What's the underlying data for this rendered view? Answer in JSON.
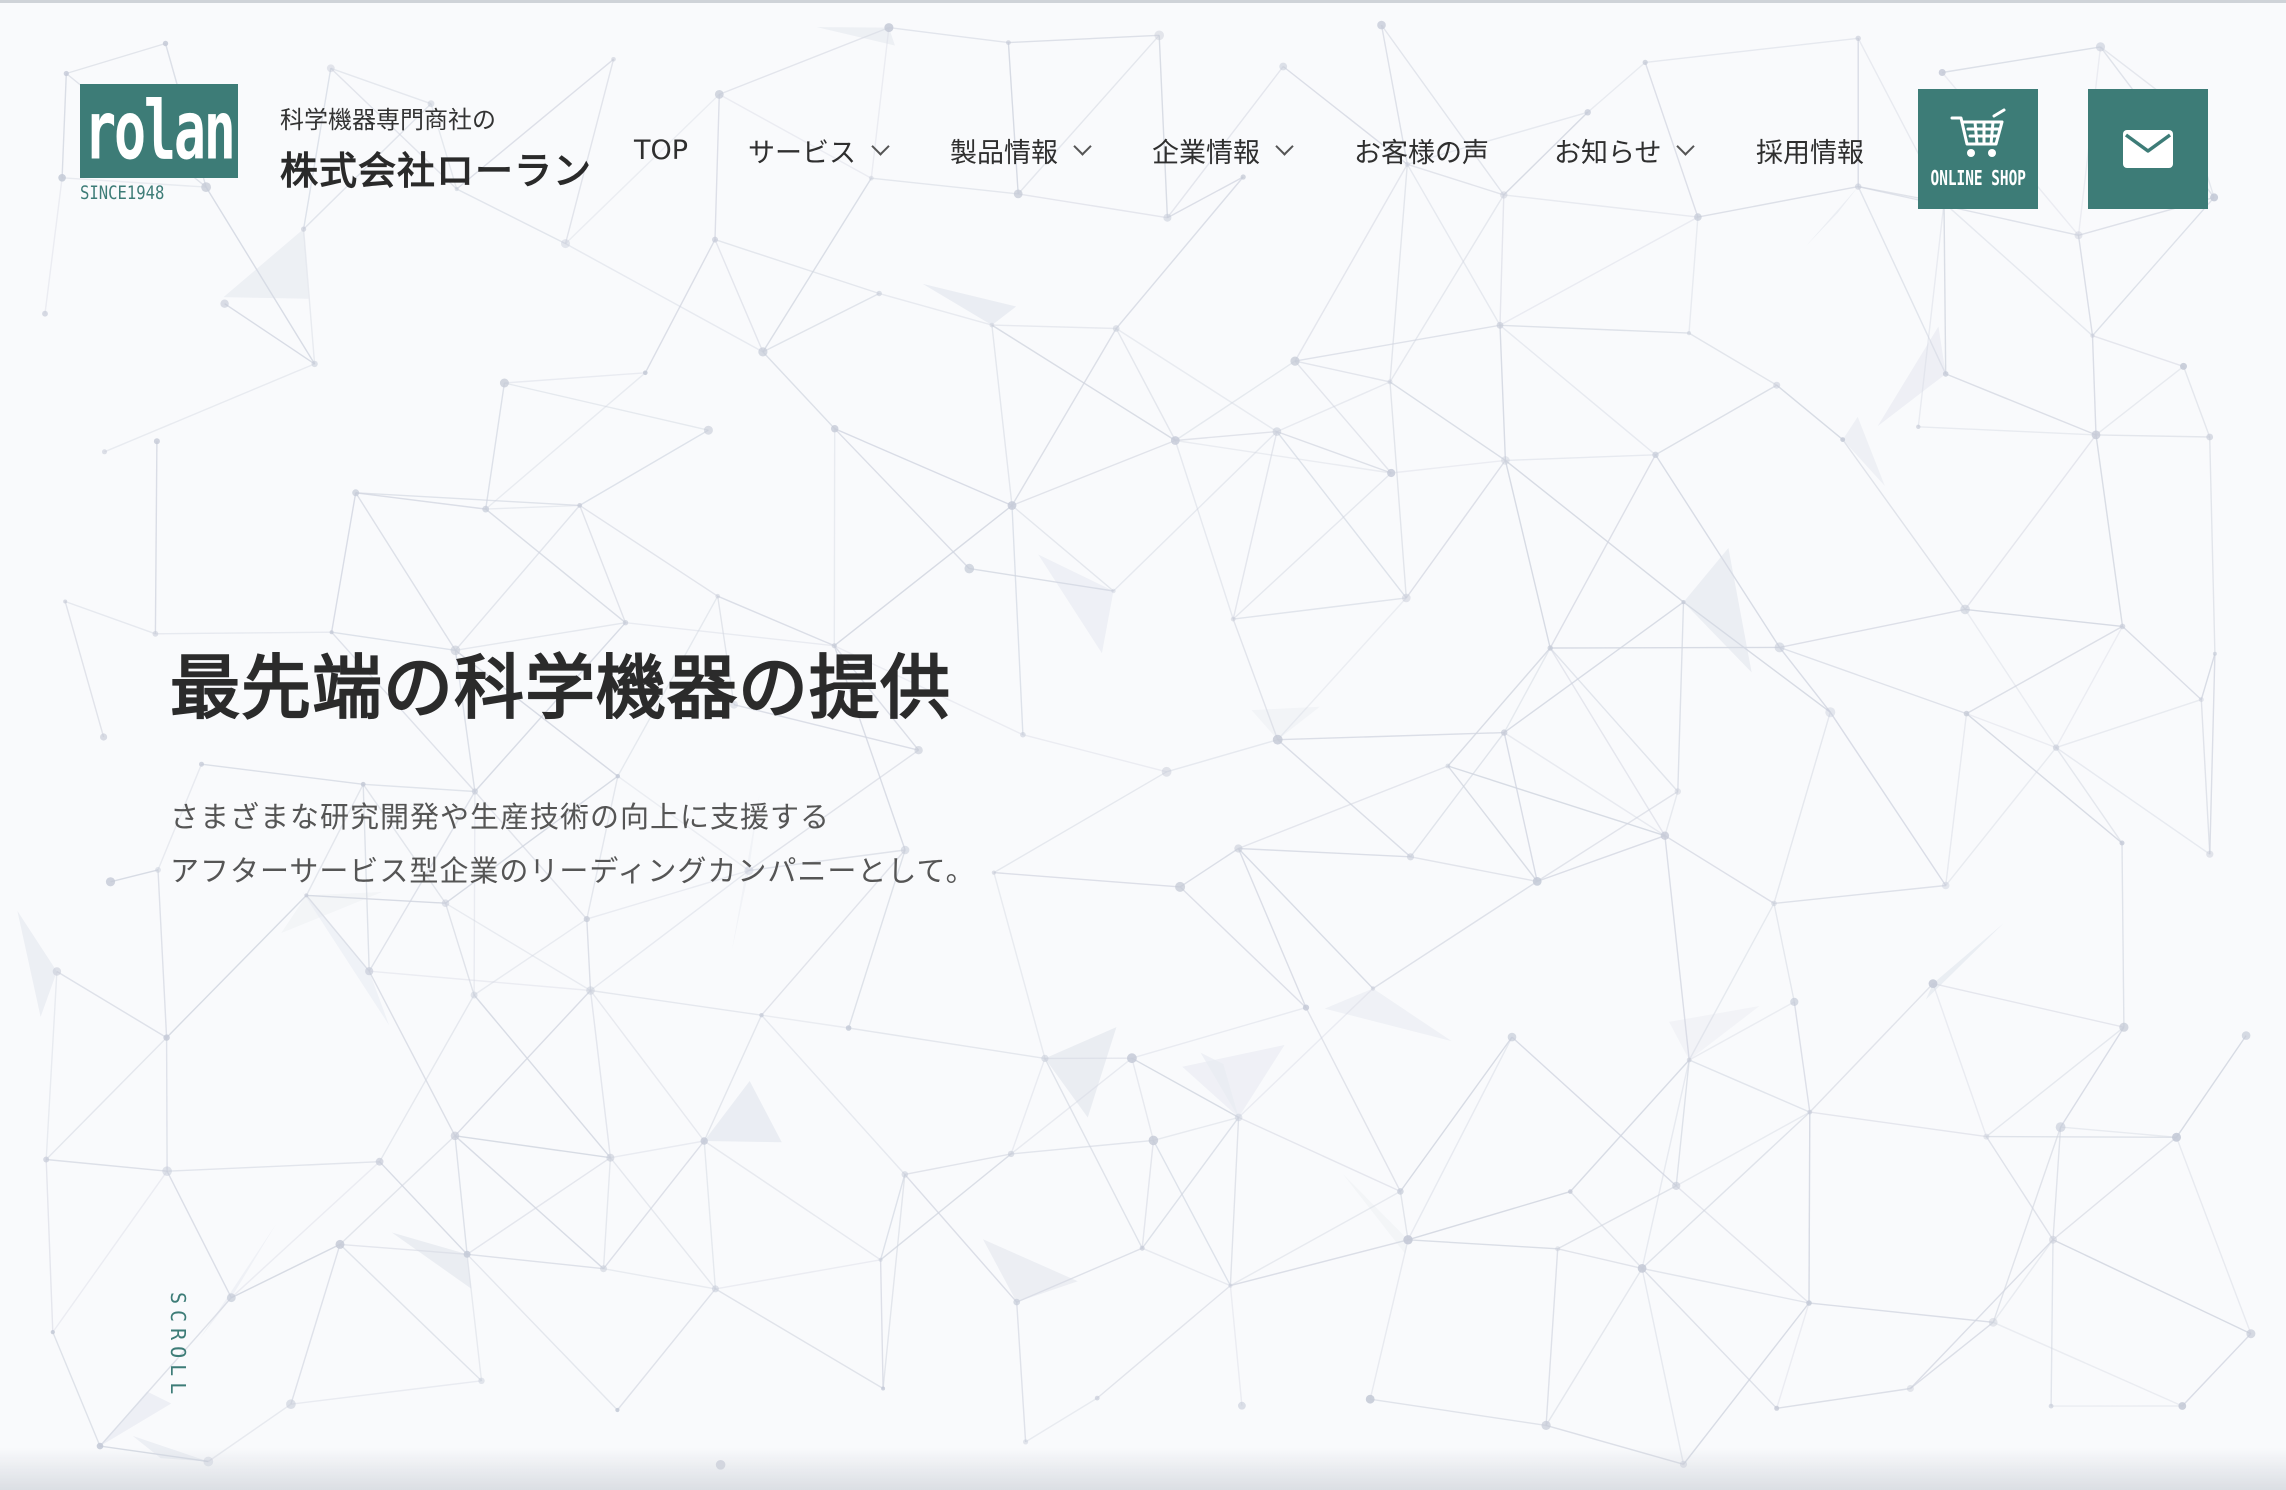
{
  "brand": {
    "logo_text": "rolan",
    "since": "SINCE1948",
    "tagline": "科学機器専門商社の",
    "name": "株式会社ローラン"
  },
  "nav": {
    "items": [
      {
        "label": "TOP",
        "dropdown": false
      },
      {
        "label": "サービス",
        "dropdown": true
      },
      {
        "label": "製品情報",
        "dropdown": true
      },
      {
        "label": "企業情報",
        "dropdown": true
      },
      {
        "label": "お客様の声",
        "dropdown": false
      },
      {
        "label": "お知らせ",
        "dropdown": true
      },
      {
        "label": "採用情報",
        "dropdown": false
      }
    ]
  },
  "actions": {
    "online_shop_label": "ONLINE SHOP",
    "online_shop_icon": "cart-icon",
    "mail_icon": "mail-icon"
  },
  "hero": {
    "title": "最先端の科学機器の提供",
    "subtitle_line1": "さまざまな研究開発や生産技術の向上に支援する",
    "subtitle_line2": "アフターサービス型企業のリーディングカンパニーとして。"
  },
  "scroll_label": "SCROLL",
  "colors": {
    "brand": "#3d7c77",
    "background": "#f9fafc",
    "text": "#2b2b2b"
  }
}
